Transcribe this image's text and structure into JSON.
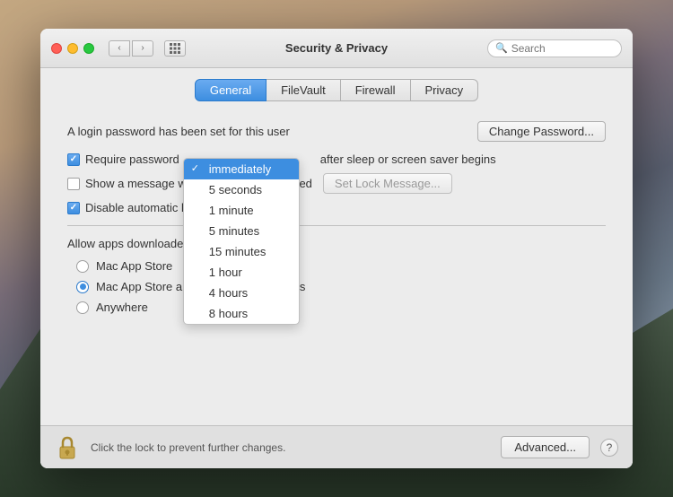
{
  "background": {
    "gradient": "mountain scene"
  },
  "window": {
    "title": "Security & Privacy",
    "traffic_lights": {
      "close_label": "close",
      "minimize_label": "minimize",
      "maximize_label": "maximize"
    },
    "nav": {
      "back_label": "‹",
      "forward_label": "›",
      "grid_label": "⊞"
    },
    "search": {
      "placeholder": "Search",
      "icon": "search-icon"
    }
  },
  "tabs": [
    {
      "id": "general",
      "label": "General",
      "active": true
    },
    {
      "id": "filevault",
      "label": "FileVault",
      "active": false
    },
    {
      "id": "firewall",
      "label": "Firewall",
      "active": false
    },
    {
      "id": "privacy",
      "label": "Privacy",
      "active": false
    }
  ],
  "general": {
    "login_password_text": "A login password has been set for this user",
    "change_password_btn": "Change Password...",
    "require_password_label": "Require password",
    "after_sleep_label": "after sleep or screen saver begins",
    "show_message_label": "Show a message when the screen is locked",
    "set_lock_message_btn": "Set Lock Message...",
    "disable_auto_label": "Disable automatic login",
    "dropdown": {
      "selected": "immediately",
      "options": [
        {
          "value": "immediately",
          "label": "immediately",
          "selected": true
        },
        {
          "value": "5seconds",
          "label": "5 seconds",
          "selected": false
        },
        {
          "value": "1minute",
          "label": "1 minute",
          "selected": false
        },
        {
          "value": "5minutes",
          "label": "5 minutes",
          "selected": false
        },
        {
          "value": "15minutes",
          "label": "15 minutes",
          "selected": false
        },
        {
          "value": "1hour",
          "label": "1 hour",
          "selected": false
        },
        {
          "value": "4hours",
          "label": "4 hours",
          "selected": false
        },
        {
          "value": "8hours",
          "label": "8 hours",
          "selected": false
        }
      ]
    },
    "allow_apps_title": "Allow apps downloaded from:",
    "radio_options": [
      {
        "id": "mac_app_store",
        "label": "Mac App Store",
        "checked": false
      },
      {
        "id": "mac_app_store_identified",
        "label": "Mac App Store and identified developers",
        "checked": true
      },
      {
        "id": "anywhere",
        "label": "Anywhere",
        "checked": false
      }
    ],
    "checkboxes": {
      "require_password": true,
      "show_message": false,
      "disable_automatic_login": true
    }
  },
  "footer": {
    "lock_text": "Click the lock to prevent further changes.",
    "advanced_btn": "Advanced...",
    "help_btn": "?"
  }
}
